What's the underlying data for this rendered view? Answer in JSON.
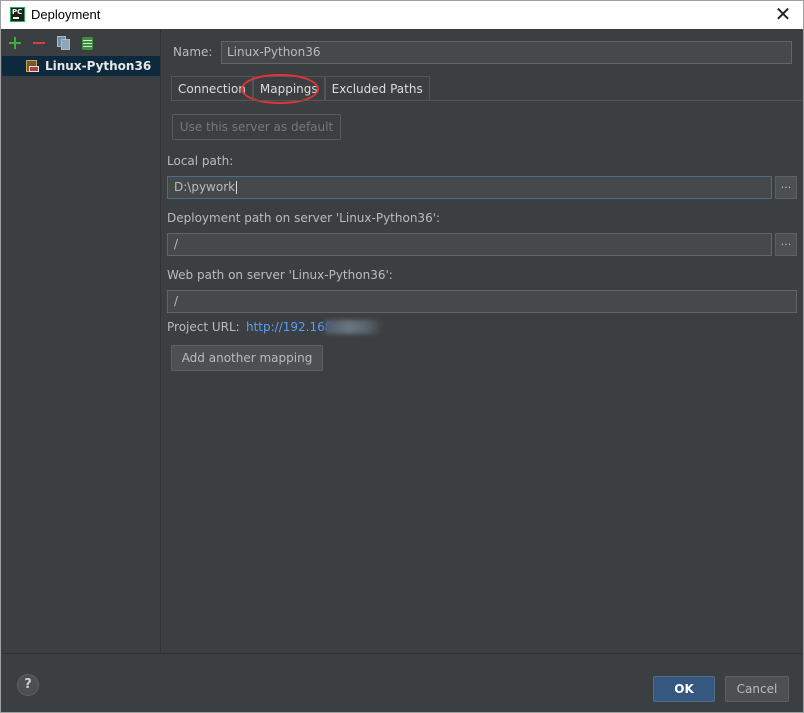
{
  "window": {
    "title": "Deployment"
  },
  "sidebar": {
    "toolbar": [
      "add-icon",
      "remove-icon",
      "copy-icon",
      "default-server-icon"
    ],
    "items": [
      {
        "label": "Linux-Python36"
      }
    ]
  },
  "form": {
    "name_label": "Name:",
    "name_value": "Linux-Python36",
    "tabs": [
      {
        "label": "Connection"
      },
      {
        "label": "Mappings"
      },
      {
        "label": "Excluded Paths"
      }
    ],
    "use_default_label": "Use this server as default",
    "local_path_label": "Local path:",
    "local_path_value": "D:\\pywork",
    "deployment_path_label": "Deployment path on server 'Linux-Python36':",
    "deployment_path_value": "/",
    "web_path_label": "Web path on server 'Linux-Python36':",
    "web_path_value": "/",
    "project_url_label": "Project URL:",
    "project_url_value": "http://192.168",
    "add_mapping_label": "Add another mapping",
    "browse_label": "..."
  },
  "footer": {
    "help_label": "?",
    "ok_label": "OK",
    "cancel_label": "Cancel"
  },
  "colors": {
    "background": "#3c3f41",
    "selection": "#0d293e",
    "link": "#589df6",
    "primary_button": "#365880",
    "highlight_circle": "#e0323c"
  }
}
